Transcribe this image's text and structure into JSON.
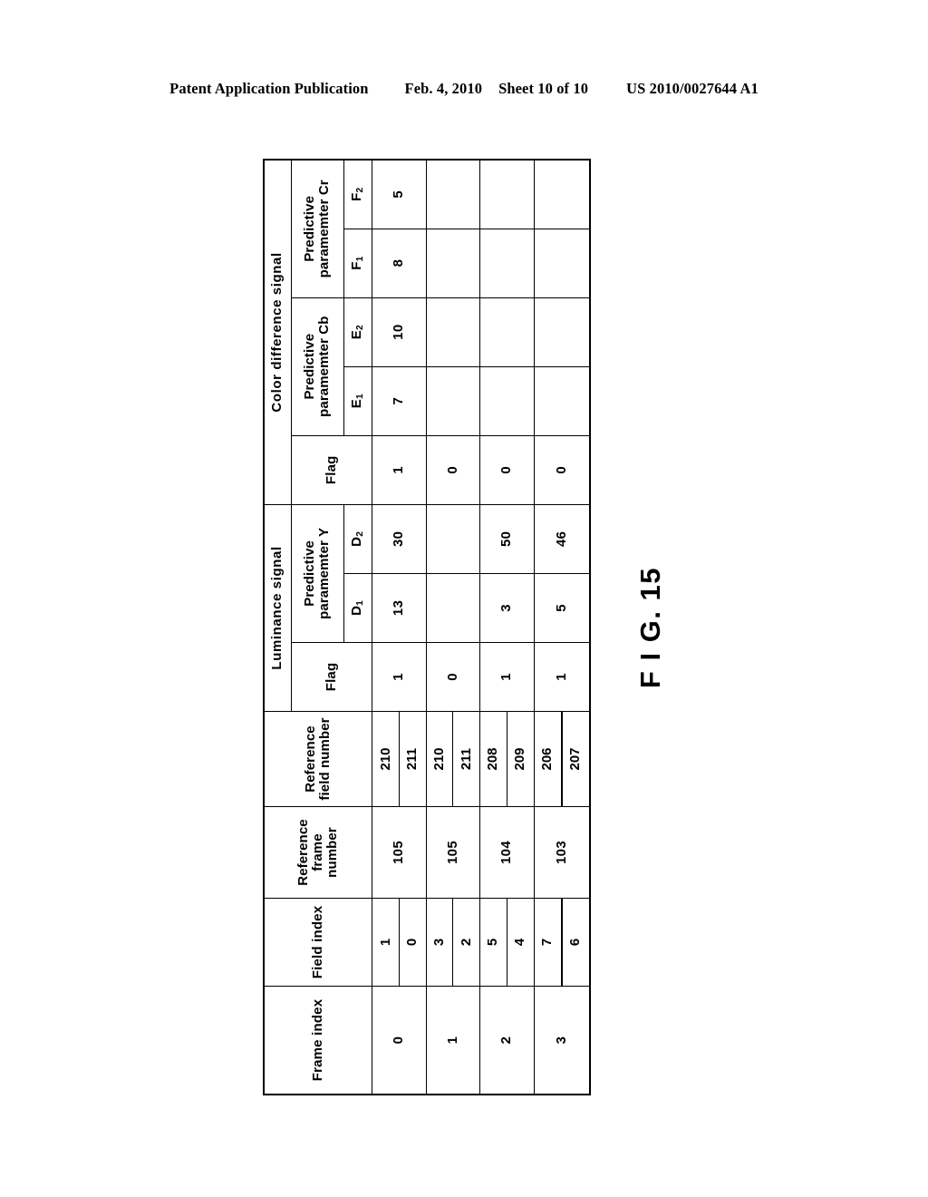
{
  "header": {
    "publication": "Patent Application Publication",
    "date": "Feb. 4, 2010",
    "sheet": "Sheet 10 of 10",
    "patent_number": "US 2010/0027644 A1"
  },
  "figure": {
    "label": "F I G. 15"
  },
  "table": {
    "group_headers": {
      "luminance_signal": "Luminance signal",
      "color_difference_signal": "Color difference signal"
    },
    "columns": {
      "frame_index": "Frame index",
      "field_index": "Field index",
      "reference_frame_number": "Reference\nframe number",
      "reference_frame_number_l1": "Reference",
      "reference_frame_number_l2": "frame number",
      "reference_field_number_l1": "Reference",
      "reference_field_number_l2": "field number",
      "flag_luminance": "Flag",
      "predictive_parameter_y_l1": "Predictive",
      "predictive_parameter_y_l2": "paramemter Y",
      "flag_color": "Flag",
      "predictive_parameter_cb_l1": "Predictive",
      "predictive_parameter_cb_l2": "paramemter Cb",
      "predictive_parameter_cr_l1": "Predictive",
      "predictive_parameter_cr_l2": "paramemter Cr",
      "d1": "D1",
      "d2": "D2",
      "e1": "E1",
      "e2": "E2",
      "f1": "F1",
      "f2": "F2"
    },
    "rows": [
      {
        "frame_index": "0",
        "reference_frame_number": "105",
        "fields": [
          {
            "field_index": "1",
            "reference_field_number": "210"
          },
          {
            "field_index": "0",
            "reference_field_number": "211"
          }
        ],
        "flag_luminance": "1",
        "d1": "13",
        "d2": "30",
        "flag_color": "1",
        "e1": "7",
        "e2": "10",
        "f1": "8",
        "f2": "5"
      },
      {
        "frame_index": "1",
        "reference_frame_number": "105",
        "fields": [
          {
            "field_index": "3",
            "reference_field_number": "210"
          },
          {
            "field_index": "2",
            "reference_field_number": "211"
          }
        ],
        "flag_luminance": "0",
        "d1": "",
        "d2": "",
        "flag_color": "0",
        "e1": "",
        "e2": "",
        "f1": "",
        "f2": ""
      },
      {
        "frame_index": "2",
        "reference_frame_number": "104",
        "fields": [
          {
            "field_index": "5",
            "reference_field_number": "208"
          },
          {
            "field_index": "4",
            "reference_field_number": "209"
          }
        ],
        "flag_luminance": "1",
        "d1": "3",
        "d2": "50",
        "flag_color": "0",
        "e1": "",
        "e2": "",
        "f1": "",
        "f2": ""
      },
      {
        "frame_index": "3",
        "reference_frame_number": "103",
        "fields": [
          {
            "field_index": "7",
            "reference_field_number": "206"
          },
          {
            "field_index": "6",
            "reference_field_number": "207"
          }
        ],
        "flag_luminance": "1",
        "d1": "5",
        "d2": "46",
        "flag_color": "0",
        "e1": "",
        "e2": "",
        "f1": "",
        "f2": ""
      }
    ]
  }
}
